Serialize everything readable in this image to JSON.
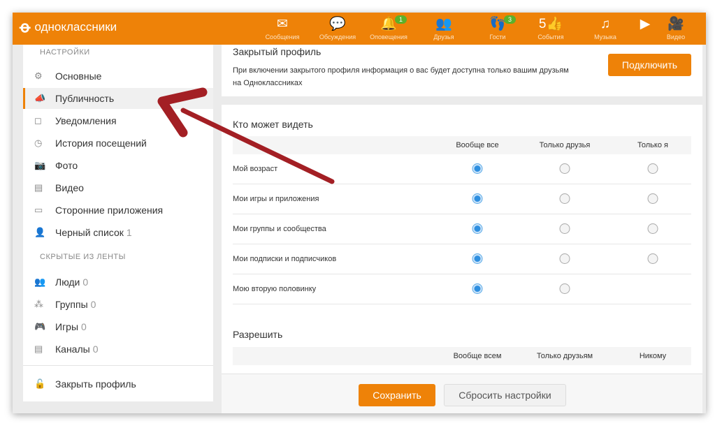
{
  "header": {
    "logo": "одноклассники",
    "nav": [
      {
        "label": "Сообщения",
        "icon": "envelope-icon",
        "glyph": "✉"
      },
      {
        "label": "Обсуждения",
        "icon": "chat-icon",
        "glyph": "💬"
      },
      {
        "label": "Оповещения",
        "icon": "bell-icon",
        "glyph": "🔔",
        "badge": "1"
      },
      {
        "label": "Друзья",
        "icon": "friends-icon",
        "glyph": "👥"
      },
      {
        "label": "Гости",
        "icon": "footprints-icon",
        "glyph": "👣",
        "badge": "3"
      },
      {
        "label": "События",
        "icon": "events-icon",
        "glyph": "5👍"
      },
      {
        "label": "Музыка",
        "icon": "music-icon",
        "glyph": "♫"
      },
      {
        "label": "",
        "icon": "video-play-icon",
        "glyph": "▶"
      },
      {
        "label": "Видео",
        "icon": "camera-icon",
        "glyph": "🎥"
      }
    ],
    "accent": "#ee8208",
    "badge_color": "#5bb12a"
  },
  "sidebar": {
    "section1": "НАСТРОЙКИ",
    "items": [
      {
        "label": "Основные",
        "icon": "gear-icon",
        "glyph": "⚙"
      },
      {
        "label": "Публичность",
        "icon": "megaphone-icon",
        "glyph": "📣",
        "active": true
      },
      {
        "label": "Уведомления",
        "icon": "notification-icon",
        "glyph": "◻"
      },
      {
        "label": "История посещений",
        "icon": "history-icon",
        "glyph": "◷"
      },
      {
        "label": "Фото",
        "icon": "camera-icon",
        "glyph": "📷"
      },
      {
        "label": "Видео",
        "icon": "film-icon",
        "glyph": "▤"
      },
      {
        "label": "Сторонние приложения",
        "icon": "apps-icon",
        "glyph": "▭"
      },
      {
        "label": "Черный список",
        "icon": "blocked-user-icon",
        "glyph": "👤",
        "count": "1"
      }
    ],
    "section2": "СКРЫТЫЕ ИЗ ЛЕНТЫ",
    "hidden": [
      {
        "label": "Люди",
        "icon": "people-icon",
        "glyph": "👥",
        "count": "0"
      },
      {
        "label": "Группы",
        "icon": "groups-icon",
        "glyph": "⁂",
        "count": "0"
      },
      {
        "label": "Игры",
        "icon": "gamepad-icon",
        "glyph": "🎮",
        "count": "0"
      },
      {
        "label": "Каналы",
        "icon": "channel-icon",
        "glyph": "▤",
        "count": "0"
      }
    ],
    "close_profile": {
      "label": "Закрыть профиль",
      "icon": "lock-icon",
      "glyph": "🔓"
    }
  },
  "closed_profile": {
    "title": "Закрытый профиль",
    "text1": "При включении закрытого профиля информация о вас будет доступна только вашим друзьям",
    "text2": "на Одноклассниках",
    "button": "Подключить"
  },
  "who_can_see": {
    "title": "Кто может видеть",
    "columns": [
      "Вообще все",
      "Только друзья",
      "Только я"
    ],
    "rows": [
      {
        "label": "Мой возраст",
        "selected": 0,
        "options": 3
      },
      {
        "label": "Мои игры и приложения",
        "selected": 0,
        "options": 3
      },
      {
        "label": "Мои группы и сообщества",
        "selected": 0,
        "options": 3
      },
      {
        "label": "Мои подписки и подписчиков",
        "selected": 0,
        "options": 3
      },
      {
        "label": "Мою вторую половинку",
        "selected": 0,
        "options": 2
      }
    ]
  },
  "allow": {
    "title": "Разрешить",
    "columns": [
      "Вообще всем",
      "Только друзьям",
      "Никому"
    ]
  },
  "footer": {
    "save": "Сохранить",
    "reset": "Сбросить настройки"
  }
}
